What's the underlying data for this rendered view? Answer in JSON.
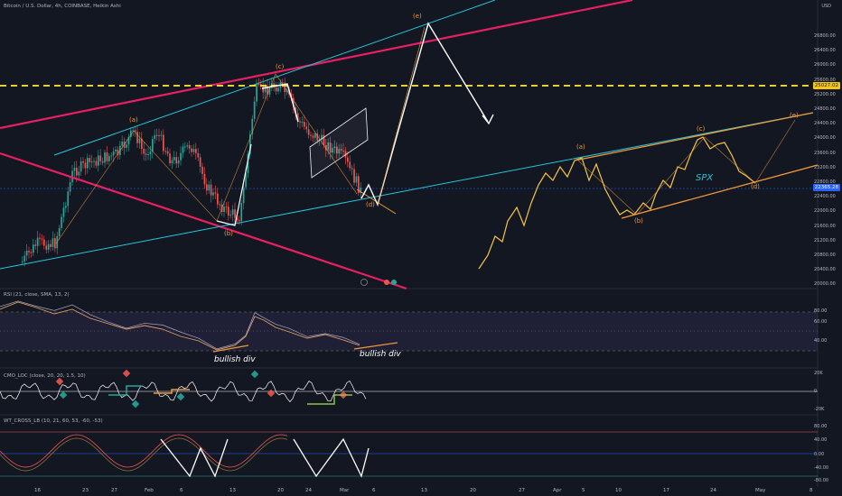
{
  "header": {
    "title": "Bitcoin / U.S. Dollar, 4h, COINBASE, Heikin Ashi"
  },
  "price_axis": {
    "currency": "USD",
    "ticks": [
      "26800.00",
      "26400.00",
      "26000.00",
      "25600.00",
      "25200.00",
      "24800.00",
      "24400.00",
      "24000.00",
      "23600.00",
      "23200.00",
      "22800.00",
      "22400.00",
      "22000.00",
      "21600.00",
      "21200.00",
      "20800.00",
      "20400.00",
      "20000.00"
    ],
    "level_tag": "25027.02",
    "current_tag": "22365.28"
  },
  "annotations": {
    "wave_labels": [
      "(e)",
      "(c)",
      "(a)",
      "(b)",
      "(d)",
      "(a)",
      "(c)",
      "(b)",
      "(d)",
      "(e)"
    ],
    "spx_label": "SPX",
    "bullish_div_1": "bullish div",
    "bullish_div_2": "bullish div"
  },
  "rsi_pane": {
    "title": "RSI (21, close, SMA, 13, 2)",
    "ticks": [
      "80.00",
      "60.00",
      "40.00"
    ]
  },
  "osc_pane": {
    "title": "CMO_LOC (close, 20, 20, 1.5, 10)",
    "ticks": [
      "20K",
      "0",
      "-20K"
    ]
  },
  "wt_pane": {
    "title": "WT_CROSS_LB (10, 21, 60, 53, -60, -53)",
    "ticks": [
      "80.00",
      "40.00",
      "0.00",
      "-40.00",
      "-80.00"
    ]
  },
  "time_axis": {
    "ticks": [
      "16",
      "23",
      "27",
      "Feb",
      "6",
      "13",
      "20",
      "24",
      "Mar",
      "6",
      "13",
      "20",
      "27",
      "Apr",
      "5",
      "10",
      "17",
      "24",
      "May",
      "8"
    ]
  },
  "colors": {
    "background": "#131722",
    "up": "#26a69a",
    "down": "#ef5350",
    "magenta_trend": "#e91e63",
    "cyan_trend": "#26c6da",
    "level_line": "#ffeb3b",
    "orange": "#f09a3a",
    "spx_line": "#f5c542",
    "rsi_line": "#e0a060",
    "rsi_band": "#7e57c2"
  }
}
